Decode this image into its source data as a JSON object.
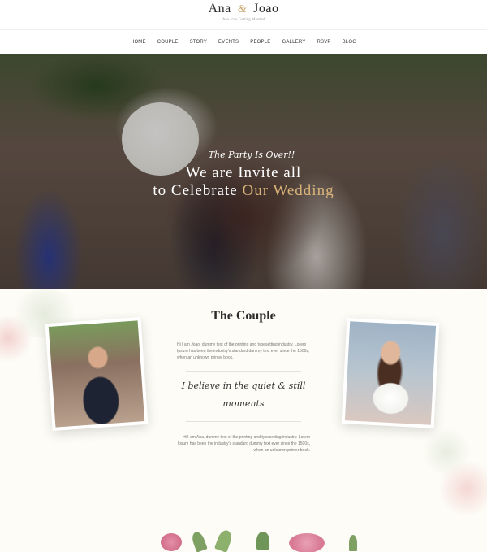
{
  "header": {
    "logo_left": "Ana",
    "logo_amp": "&",
    "logo_right": "Joao",
    "tagline": "Ana Joao Getting Married"
  },
  "nav": {
    "items": [
      "HOME",
      "COUPLE",
      "STORY",
      "EVENTS",
      "PEOPLE",
      "GALLERY",
      "RSVP",
      "BLOG"
    ]
  },
  "hero": {
    "pre_title": "The Party Is Over!!",
    "line1": "We are Invite all",
    "line2_prefix": "to Celebrate",
    "line2_highlight": "Our Wedding"
  },
  "couple": {
    "title": "The Couple",
    "joao_text": "Hi I am Joao. dummy text of the printing and typesetting industry. Lorem Ipsum has been the industry's standard dummy text ever since the 1500s, when an unknown printer book.",
    "quote": "I believe in the quiet & still moments",
    "ana_text": "Hi I am Ana. dummy text of the printing and typesetting industry. Lorem Ipsum has been the industry's standard dummy text ever since the 1500s, when an unknown printer book."
  },
  "colors": {
    "accent_gold": "#d9b37a",
    "section_bg": "#fdfcf6",
    "text_dark": "#2b2b2b"
  }
}
